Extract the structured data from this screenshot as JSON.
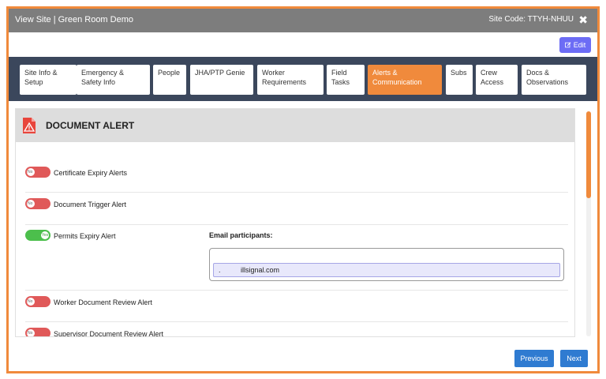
{
  "window": {
    "title": "View Site | Green Room Demo",
    "site_code": "Site Code: TTYH-NHUU",
    "close_glyph": "✖"
  },
  "toolbar": {
    "edit_label": "Edit"
  },
  "tabs": [
    {
      "label": "Site Info & Setup",
      "active": false
    },
    {
      "label": "Emergency & Safety Info",
      "active": false
    },
    {
      "label": "People",
      "active": false
    },
    {
      "label": "JHA/PTP Genie",
      "active": false
    },
    {
      "label": "Worker Requirements",
      "active": false
    },
    {
      "label": "Field Tasks",
      "active": false
    },
    {
      "label": "Alerts & Communication",
      "active": true
    },
    {
      "label": "Subs",
      "active": false
    },
    {
      "label": "Crew Access",
      "active": false
    },
    {
      "label": "Docs & Observations",
      "active": false
    }
  ],
  "section": {
    "heading": "DOCUMENT ALERT",
    "icon": "document-warning-icon"
  },
  "alerts": [
    {
      "label": "Certificate Expiry Alerts",
      "toggle_text": "No",
      "on": false
    },
    {
      "label": "Document Trigger Alert",
      "toggle_text": "No",
      "on": false
    },
    {
      "label": "Permits Expiry Alert",
      "toggle_text": "Yes",
      "on": true
    },
    {
      "label": "Worker Document Review Alert",
      "toggle_text": "No",
      "on": false
    },
    {
      "label": "Supervisor Document Review Alert",
      "toggle_text": "No",
      "on": false
    }
  ],
  "email": {
    "label": "Email participants:",
    "chip_prefix": ".",
    "chip_value": "illsignal.com"
  },
  "footer": {
    "previous_label": "Previous",
    "next_label": "Next"
  },
  "colors": {
    "accent": "#f08a3c",
    "tabbar": "#3b475c",
    "titlebar": "#7d7d7d",
    "edit": "#6c6cf5",
    "nav_button": "#2f7bd1",
    "toggle_off": "#e05959",
    "toggle_on": "#4cbf4c"
  }
}
